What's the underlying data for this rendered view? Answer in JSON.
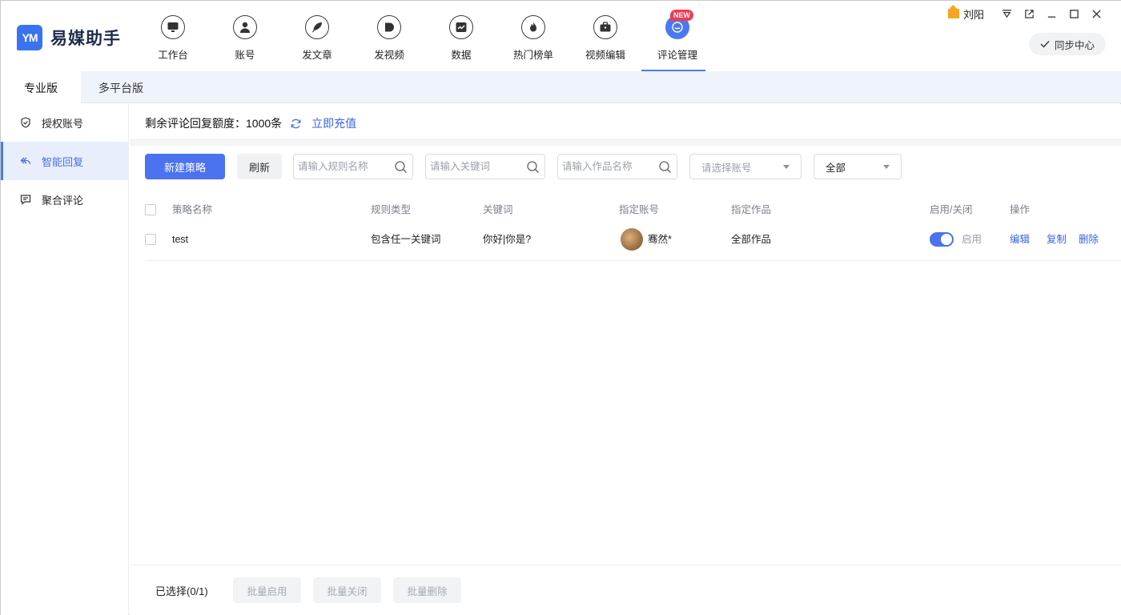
{
  "app": {
    "name": "易媒助手",
    "logo_mark": "YM"
  },
  "nav": {
    "items": [
      {
        "label": "工作台",
        "icon": "monitor-icon"
      },
      {
        "label": "账号",
        "icon": "user-icon"
      },
      {
        "label": "发文章",
        "icon": "feather-icon"
      },
      {
        "label": "发视频",
        "icon": "play-icon"
      },
      {
        "label": "数据",
        "icon": "chart-icon"
      },
      {
        "label": "热门榜单",
        "icon": "flame-icon"
      },
      {
        "label": "视频编辑",
        "icon": "toolbox-icon"
      },
      {
        "label": "评论管理",
        "icon": "comment-icon",
        "badge": "NEW",
        "active": true
      }
    ]
  },
  "window": {
    "user_name": "刘阳",
    "sync_label": "同步中心"
  },
  "tabs": [
    {
      "label": "专业版",
      "active": true
    },
    {
      "label": "多平台版",
      "active": false
    }
  ],
  "sidebar": {
    "items": [
      {
        "label": "授权账号",
        "icon": "shield-icon"
      },
      {
        "label": "智能回复",
        "icon": "reply-icon",
        "active": true
      },
      {
        "label": "聚合评论",
        "icon": "message-list-icon"
      }
    ]
  },
  "quota": {
    "label": "剩余评论回复额度：",
    "value": "1000条",
    "recharge_link": "立即充值"
  },
  "toolbar": {
    "new_button": "新建策略",
    "refresh_button": "刷新",
    "rule_search_placeholder": "请输入规则名称",
    "keyword_search_placeholder": "请输入关键词",
    "work_search_placeholder": "请输入作品名称",
    "account_select_placeholder": "请选择账号",
    "status_select_value": "全部"
  },
  "table": {
    "headers": {
      "name": "策略名称",
      "rule_type": "规则类型",
      "keywords": "关键词",
      "account": "指定账号",
      "works": "指定作品",
      "enabled": "启用/关闭",
      "actions": "操作"
    },
    "rows": [
      {
        "name": "test",
        "rule_type": "包含任一关键词",
        "keywords": "你好|你是?",
        "account": "骞然*",
        "works": "全部作品",
        "enabled": true,
        "enabled_label": "启用",
        "actions": [
          "编辑",
          "复制",
          "删除"
        ]
      }
    ]
  },
  "footer": {
    "selected": "已选择(0/1)",
    "batch_enable": "批量启用",
    "batch_disable": "批量关闭",
    "batch_delete": "批量删除"
  },
  "colors": {
    "accent": "#4b72ef",
    "badge": "#f23a55",
    "link": "#3a63e3"
  }
}
